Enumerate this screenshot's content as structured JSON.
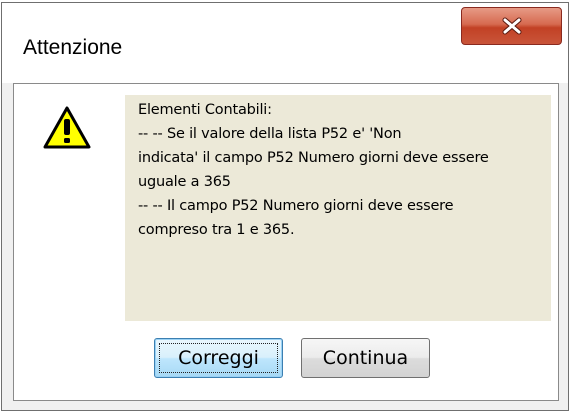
{
  "window": {
    "title": "Attenzione",
    "close_icon": "close-icon"
  },
  "message": {
    "icon": "warning-icon",
    "lines": [
      "Elementi Contabili:",
      "-- --  Se il valore della lista P52 e' 'Non",
      "indicata' il campo P52 Numero giorni deve essere",
      "uguale a 365",
      "-- --  Il campo P52 Numero giorni deve essere",
      "compreso tra 1 e 365."
    ]
  },
  "buttons": {
    "correggi_label": "Correggi",
    "continua_label": "Continua"
  },
  "colors": {
    "panel_bg": "#ece9d8",
    "close_button": "#c24125",
    "warning_fill": "#ffff00"
  }
}
